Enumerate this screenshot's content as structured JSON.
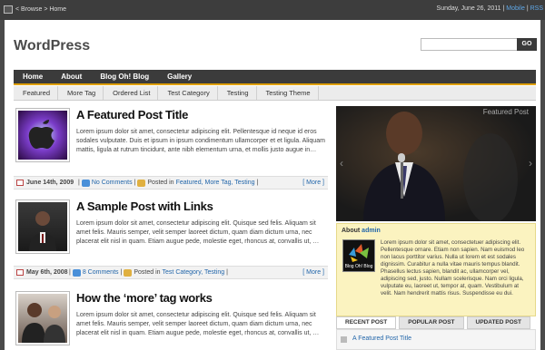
{
  "topbar": {
    "breadcrumb": "< Browse > Home",
    "date": "Sunday, June 26, 2011",
    "sep": "|",
    "mobile": "Mobile",
    "rss": "RSS"
  },
  "site": {
    "title": "WordPress",
    "search_placeholder": "",
    "go_label": "GO"
  },
  "nav": [
    "Home",
    "About",
    "Blog Oh! Blog",
    "Gallery"
  ],
  "subnav": [
    "Featured",
    "More Tag",
    "Ordered List",
    "Test Category",
    "Testing",
    "Testing Theme"
  ],
  "posts": [
    {
      "title": "A Featured Post Title",
      "excerpt": "Lorem ipsum dolor sit amet, consectetur adipiscing elit. Pellentesque id neque id eros sodales vulputate. Duis et ipsum in ipsum condimentum ullamcorper et et ligula. Aliquam mattis, ligula at rutrum tincidunt, ante nibh elementum urna, et mollis justo augue in…",
      "date": "June 14th, 2009",
      "comments": "No Comments",
      "posted_in": "Posted in",
      "tags": "Featured, More Tag, Testing",
      "more": "[ More ]"
    },
    {
      "title": "A Sample Post with Links",
      "excerpt": "Lorem ipsum dolor sit amet, consectetur adipiscing elit. Quisque sed felis. Aliquam sit amet felis. Mauris semper, velit semper laoreet dictum, quam diam dictum urna, nec placerat elit nisl in quam. Etiam augue pede, molestie eget, rhoncus at, convallis ut, …",
      "date": "May 6th, 2008",
      "comments": "8 Comments",
      "posted_in": "Posted in",
      "tags": "Test Category, Testing",
      "more": "[ More ]"
    },
    {
      "title": "How the ‘more’ tag works",
      "excerpt": "Lorem ipsum dolor sit amet, consectetur adipiscing elit. Quisque sed felis. Aliquam sit amet felis. Mauris semper, velit semper laoreet dictum, quam diam dictum urna, nec placerat elit nisl in quam. Etiam augue pede, molestie eget, rhoncus at, convallis ut, …"
    }
  ],
  "sidebar": {
    "featured_label": "Featured Post",
    "about_prefix": "About",
    "about_name": "admin",
    "about_text": "Lorem ipsum dolor sit amet, consectetuer adipiscing elit. Pellentesque ornare. Etiam non sapien. Nam euismod leo non lacus porttitor varius. Nulla ut lorem et est sodales dignissim. Curabitur a nulla vitae mauris tempus blandit. Phasellus lectus sapien, blandit ac, ullamcorper vel, adipiscing sed, justo. Nullam scelerisque. Nam orci ligula, vulputate eu, laoreet ut, tempor at, quam. Vestibulum at velit. Nam hendrerit mattis risus. Suspendisse eu dui.",
    "logo_text": "Blog Oh! Blog",
    "tabs": [
      "RECENT POST",
      "POPULAR POST",
      "UPDATED POST"
    ],
    "recent_first": "A Featured Post Title"
  }
}
